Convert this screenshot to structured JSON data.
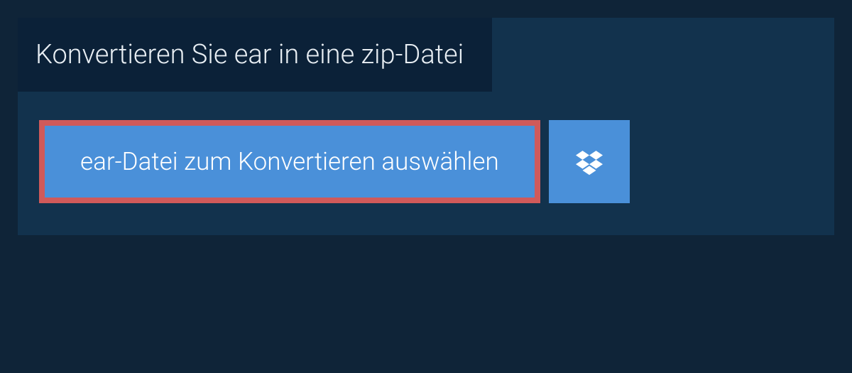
{
  "header": {
    "title": "Konvertieren Sie ear in eine zip-Datei"
  },
  "actions": {
    "select_file_label": "ear-Datei zum Konvertieren auswählen"
  },
  "colors": {
    "page_bg": "#0f2438",
    "panel_bg": "#12324d",
    "title_tab_bg": "#0b2138",
    "button_bg": "#4a90d9",
    "highlight_border": "#d05a5a",
    "text_light": "#e8eef3"
  }
}
